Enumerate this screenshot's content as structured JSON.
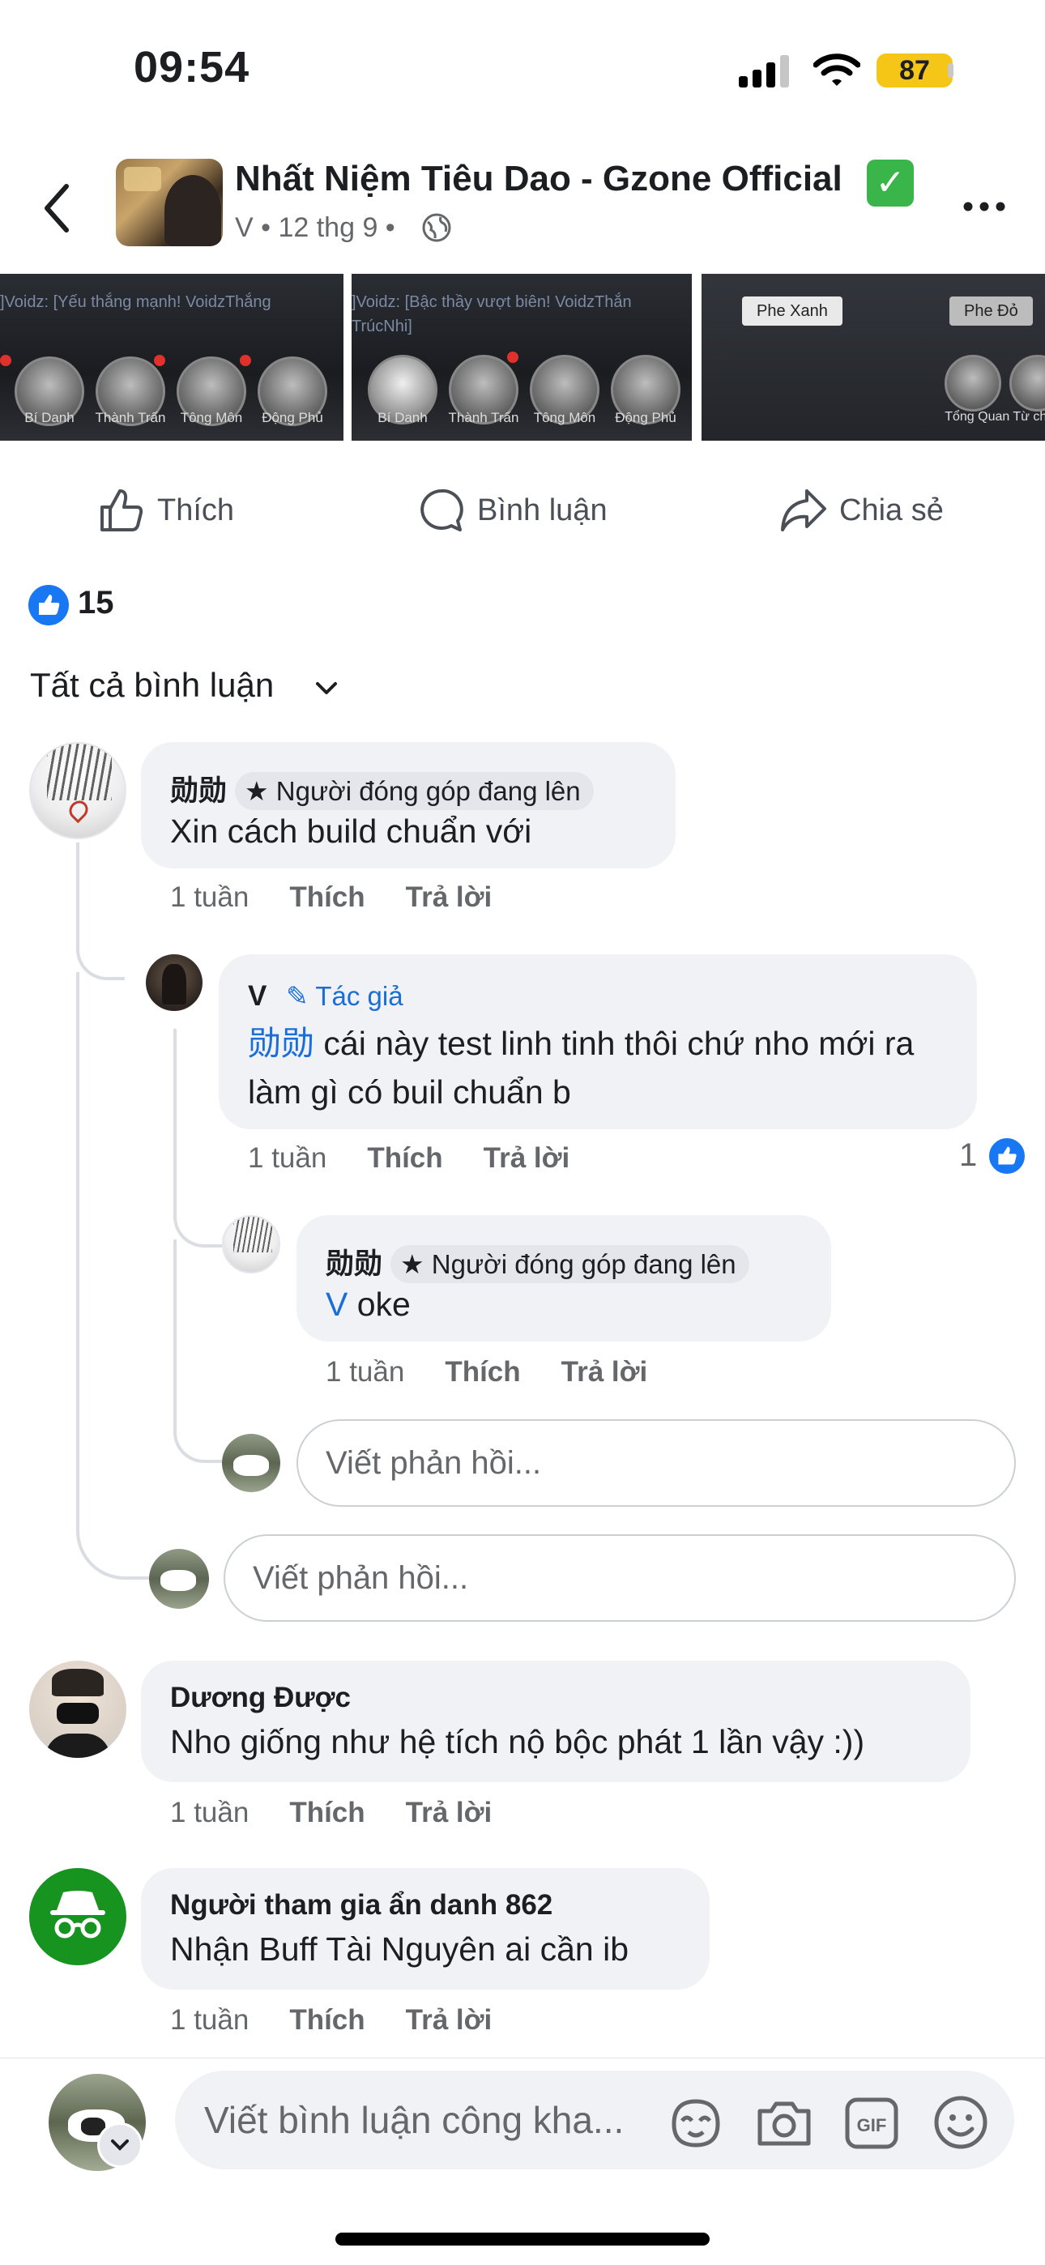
{
  "status": {
    "time": "09:54",
    "battery": "87"
  },
  "header": {
    "page_name": "Nhất Niệm Tiêu Dao - Gzone Official",
    "author": "V",
    "date": "12 thg 9",
    "post_meta": "V • 12 thg 9 •"
  },
  "images": [
    {
      "chat": "]Voidz: [Yếu thắng mạnh! VoidzThắng",
      "labels": [
        "Bí Danh",
        "Thành Trấn",
        "Tông Môn",
        "Động Phủ"
      ]
    },
    {
      "chat": "]Voidz: [Bậc thầy vượt biên! VoidzThắn",
      "chat2": "TrúcNhi]",
      "labels": [
        "Bí Danh",
        "Thành Trấn",
        "Tông Môn",
        "Động Phủ"
      ]
    },
    {
      "pills": [
        "Phe Xanh",
        "Phe Đỏ"
      ],
      "labels": [
        "Tổng Quan Từ chi"
      ]
    }
  ],
  "actions": {
    "like": "Thích",
    "comment": "Bình luận",
    "share": "Chia sẻ"
  },
  "reactions": {
    "count": "15"
  },
  "sort": {
    "label": "Tất cả bình luận"
  },
  "comments": [
    {
      "name": "勋勋",
      "badge": "Người đóng góp đang lên",
      "text": "Xin cách build chuẩn với",
      "time": "1 tuần",
      "like": "Thích",
      "reply": "Trả lời",
      "replies": [
        {
          "name": "V",
          "badge": "Tác giả",
          "mention": "勋勋",
          "text": " cái này test linh tinh thôi chứ nho mới ra làm gì có buil chuẩn b",
          "time": "1 tuần",
          "like": "Thích",
          "reply": "Trả lời",
          "reaction_count": "1"
        },
        {
          "name": "勋勋",
          "badge": "Người đóng góp đang lên",
          "mention": "V",
          "text": " oke",
          "time": "1 tuần",
          "like": "Thích",
          "reply": "Trả lời"
        }
      ],
      "reply_placeholder_inner": "Viết phản hồi...",
      "reply_placeholder_outer": "Viết phản hồi..."
    },
    {
      "name": "Dương Được",
      "text": "Nho giống như hệ tích nộ bộc phát 1 lần vậy :))",
      "time": "1 tuần",
      "like": "Thích",
      "reply": "Trả lời"
    },
    {
      "name": "Người tham gia ẩn danh 862",
      "text": "Nhận Buff Tài Nguyên ai cần ib",
      "time": "1 tuần",
      "like": "Thích",
      "reply": "Trả lời"
    }
  ],
  "composer": {
    "placeholder": "Viết bình luận công kha..."
  },
  "colors": {
    "accent": "#1877f2",
    "verified": "#39b54a",
    "anon_avatar": "#16941f",
    "battery": "#f5c518"
  }
}
